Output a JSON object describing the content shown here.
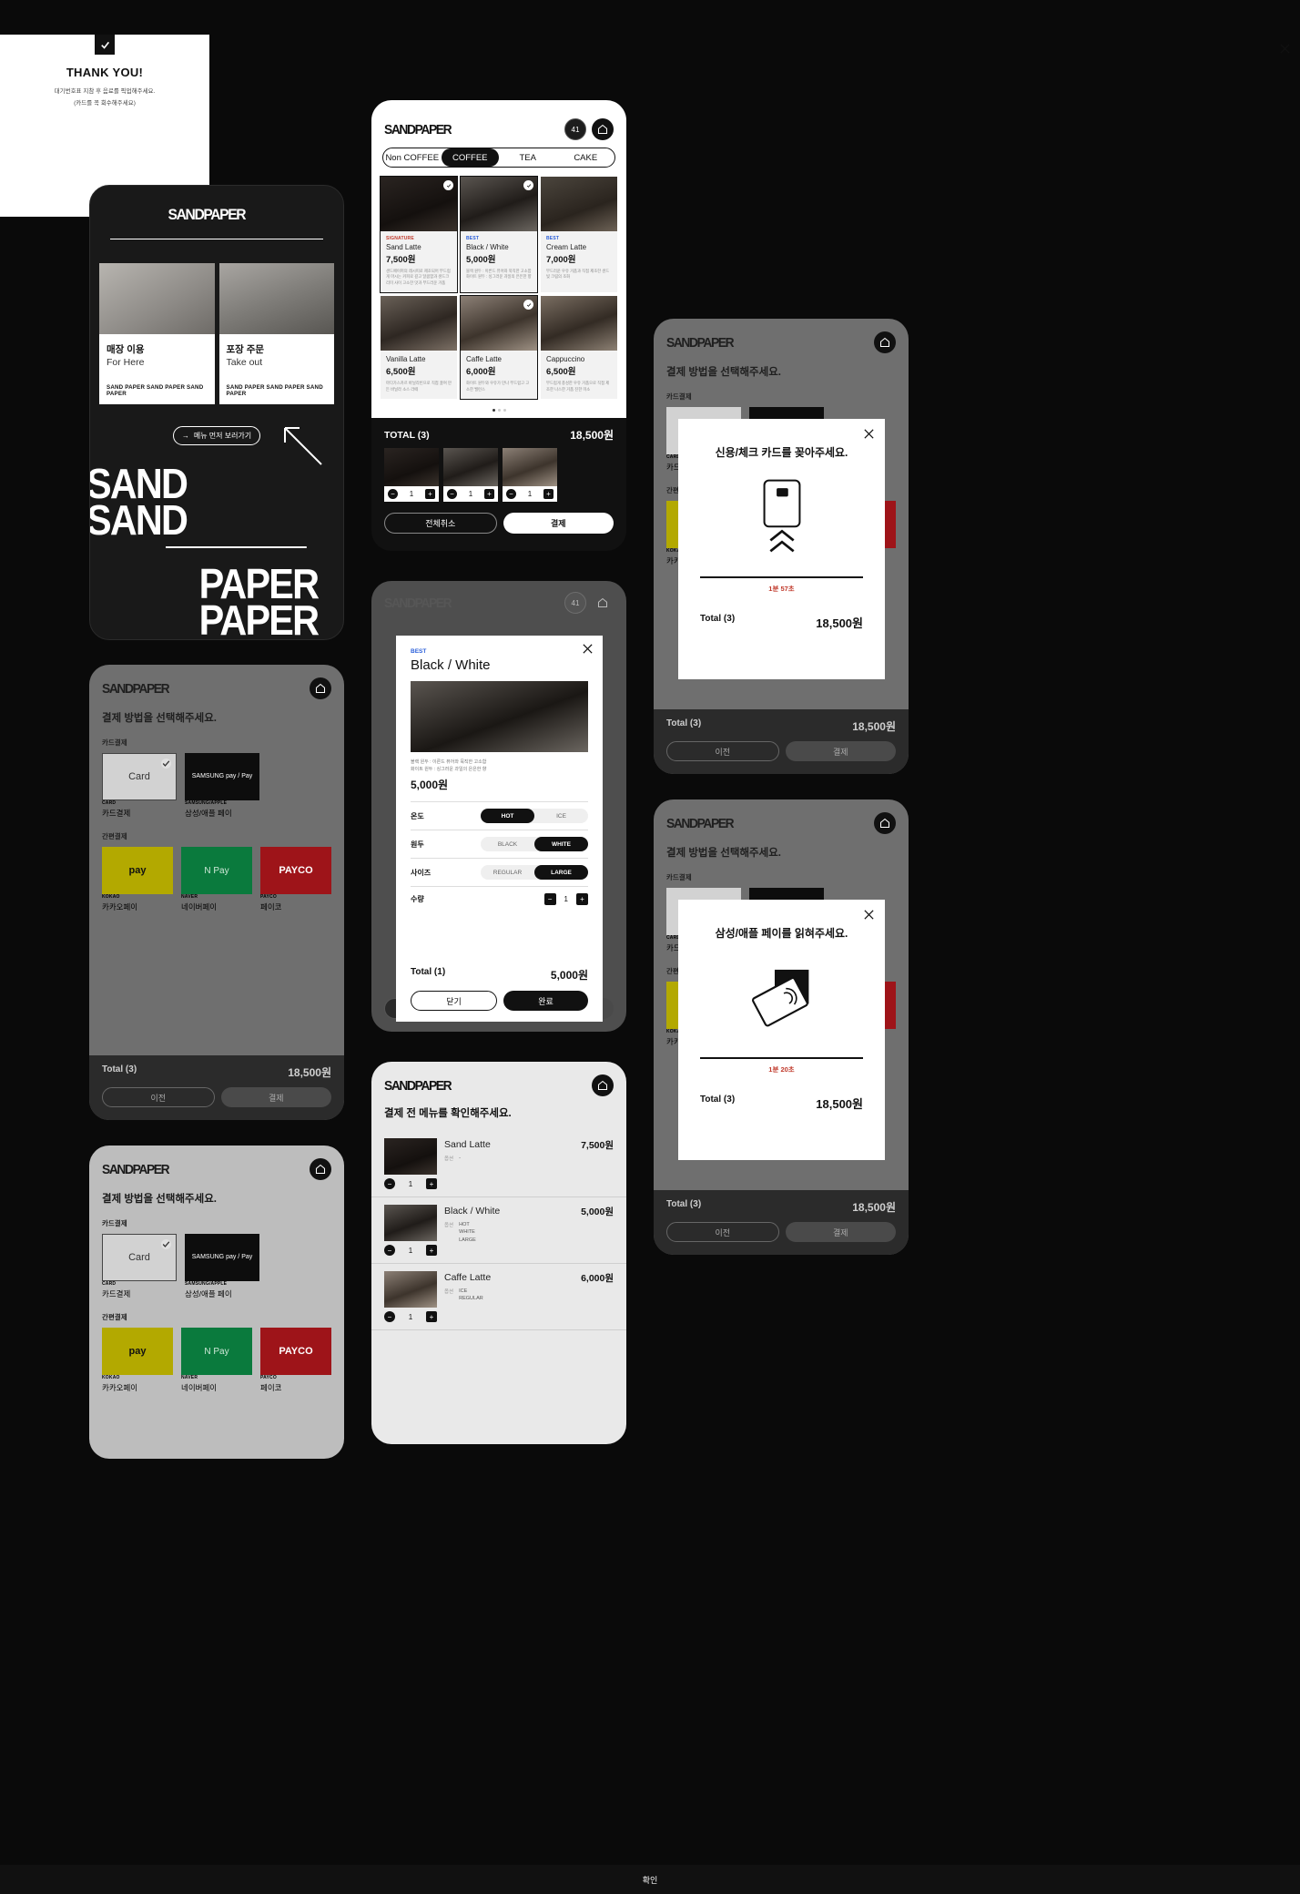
{
  "brand": {
    "logo": "SANDPAPER",
    "home_icon": "home-icon",
    "cart_badge": "41"
  },
  "intro": {
    "logo": "SANDPAPER",
    "modes": [
      {
        "kr": "매장 이용",
        "en": "For Here",
        "marquee": "SAND PAPER SAND PAPER SAND PAPER"
      },
      {
        "kr": "포장 주문",
        "en": "Take out",
        "marquee": "SAND PAPER SAND PAPER SAND PAPER"
      }
    ],
    "menu_button": "메뉴 먼저 보러가기",
    "arrow_icon": "arrow-up-left-icon",
    "type_lines": [
      "SAND",
      "SAND",
      "PAPER",
      "PAPER"
    ]
  },
  "menu": {
    "tabs": [
      {
        "label": "Non COFFEE",
        "active": false
      },
      {
        "label": "COFFEE",
        "active": true
      },
      {
        "label": "TEA",
        "active": false
      },
      {
        "label": "CAKE",
        "active": false
      }
    ],
    "items": [
      {
        "tag": "SIGNATURE",
        "tag_kind": "signature",
        "name": "Sand Latte",
        "price": "7,500원",
        "desc": "샌드페이퍼의 레시피로 제조되어 부드럽게 마시는 커피로 깊고 달콤함과 샌드크리미 사이 고소한 맛과 부드러운 거품",
        "selected": true
      },
      {
        "tag": "BEST",
        "tag_kind": "best",
        "name": "Black / White",
        "price": "5,000원",
        "desc": "블랙 원두 : 이른드 퓨어와 묵직한 고소함 화이트 원두 : 싱그러운 과일의 은은한 향",
        "selected": true
      },
      {
        "tag": "BEST",
        "tag_kind": "best",
        "name": "Cream Latte",
        "price": "7,000원",
        "desc": "부드러운 우유 거품과 직접 제조한 샌드빛 크림의 조화",
        "selected": false
      },
      {
        "tag": "",
        "tag_kind": "",
        "name": "Vanilla Latte",
        "price": "6,500원",
        "desc": "마다가스카르 바닐라빈으로 직접 끓여 만든 바닐라 소스 라떼",
        "selected": false
      },
      {
        "tag": "",
        "tag_kind": "",
        "name": "Caffe Latte",
        "price": "6,000원",
        "desc": "화이트 원두와 우유가 만나 부드럽고 고소한 밸런스",
        "selected": true
      },
      {
        "tag": "",
        "tag_kind": "",
        "name": "Cappuccino",
        "price": "6,500원",
        "desc": "부드럽게 풍성한 우유 거품으로 직접 제조한 나스한 거품 진한 미소",
        "selected": false
      }
    ],
    "total_label": "TOTAL (3)",
    "total_value": "18,500원",
    "cart": [
      {
        "qty": "1"
      },
      {
        "qty": "1"
      },
      {
        "qty": "1"
      }
    ],
    "cancel_all": "전체취소",
    "pay": "결제"
  },
  "detail": {
    "tag": "BEST",
    "name": "Black / White",
    "desc": "블랙 원두 : 이른드 퓨어와 묵직한 고소함\n화이트 원두 : 싱그러운 과일의 은은한 향",
    "price": "5,000원",
    "options": [
      {
        "label": "온도",
        "choices": [
          "HOT",
          "ICE"
        ],
        "selected": "HOT"
      },
      {
        "label": "원두",
        "choices": [
          "BLACK",
          "WHITE"
        ],
        "selected": "WHITE"
      },
      {
        "label": "사이즈",
        "choices": [
          "REGULAR",
          "LARGE"
        ],
        "selected": "LARGE"
      }
    ],
    "qty_label": "수량",
    "qty": "1",
    "total_label": "Total (1)",
    "total_value": "5,000원",
    "close": "닫기",
    "done": "완료",
    "close_icon": "close-icon"
  },
  "confirm": {
    "title": "결제 전 메뉴를 확인해주세요.",
    "option_label": "옵션",
    "rows": [
      {
        "name": "Sand Latte",
        "price": "7,500원",
        "qty": "1",
        "options": "-"
      },
      {
        "name": "Black / White",
        "price": "5,000원",
        "qty": "1",
        "options": "HOT\nWHITE\nLARGE"
      },
      {
        "name": "Caffe Latte",
        "price": "6,000원",
        "qty": "1",
        "options": "ICE\nREGULAR"
      }
    ]
  },
  "payment": {
    "title": "결제 방법을 선택해주세요.",
    "card_section": "카드결제",
    "easy_section": "간편결제",
    "card_methods": [
      {
        "tile": "Card",
        "kind": "card",
        "code": "CARD",
        "name": "카드결제",
        "selected": true
      },
      {
        "tile": "SAMSUNG pay / Pay",
        "kind": "sampay",
        "code": "SAMSUNG/APPLE",
        "name": "삼성/애플 페이",
        "selected": false
      }
    ],
    "easy_methods": [
      {
        "tile": "pay",
        "kind": "kakao",
        "code": "KOKAO",
        "name": "카카오페이"
      },
      {
        "tile": "N Pay",
        "kind": "naver",
        "code": "NAVER",
        "name": "네이버페이"
      },
      {
        "tile": "PAYCO",
        "kind": "payco",
        "code": "PAYCO",
        "name": "페이코"
      }
    ],
    "total_label": "Total (3)",
    "total_value": "18,500원",
    "prev": "이전",
    "pay": "결제"
  },
  "thank_you": {
    "check_icon": "check-icon",
    "title": "THANK YOU!",
    "line1": "대기번호표 지참 후 음료를 픽업해주세요.",
    "line2": "(카드를 꼭 회수해주세요)",
    "confirm": "확인",
    "close_icon": "close-icon"
  },
  "card_insert_modal": {
    "title": "신용/체크 카드를 꽂아주세요.",
    "art_icon": "card-insert-icon",
    "timer": "1분 57초",
    "total_label": "Total (3)",
    "total_value": "18,500원",
    "close_icon": "close-icon"
  },
  "pay_read_modal": {
    "title": "삼성/애플 페이를 읽혀주세요.",
    "art_icon": "contactless-card-icon",
    "timer": "1분 20초",
    "total_label": "Total (3)",
    "total_value": "18,500원",
    "close_icon": "close-icon"
  }
}
